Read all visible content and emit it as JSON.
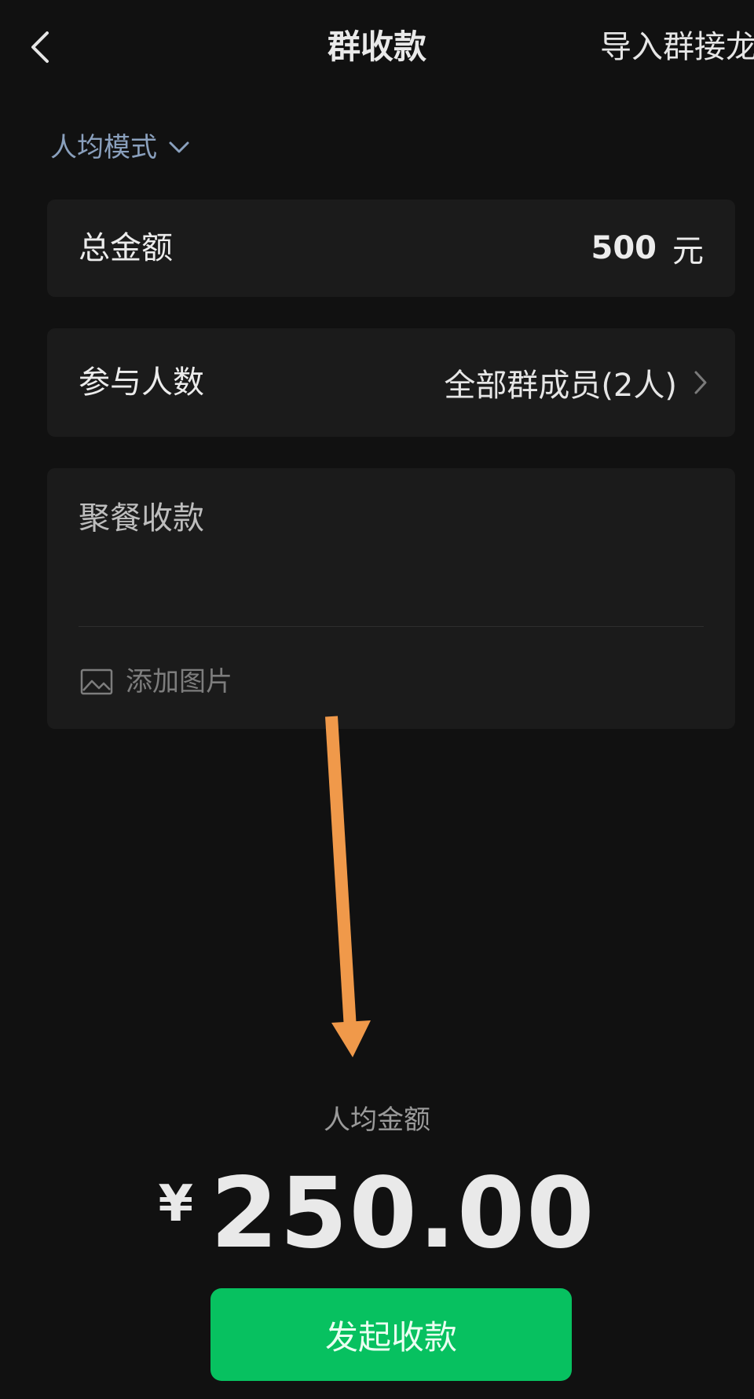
{
  "header": {
    "title": "群收款",
    "import_label": "导入群接龙"
  },
  "mode": {
    "label": "人均模式"
  },
  "total": {
    "label": "总金额",
    "value": "500",
    "unit": "元"
  },
  "participants": {
    "label": "参与人数",
    "value": "全部群成员(2人)"
  },
  "note": {
    "text": "聚餐收款",
    "add_image_label": "添加图片"
  },
  "per_person": {
    "label": "人均金额",
    "currency": "¥",
    "amount": "250.00"
  },
  "submit": {
    "label": "发起收款"
  },
  "colors": {
    "background": "#111111",
    "card": "#1b1b1b",
    "accent_green": "#07c160",
    "mode_blue": "#8aa0bd",
    "annotation_arrow": "#f0994a"
  },
  "icons": {
    "back": "chevron-left-icon",
    "mode_dropdown": "chevron-down-icon",
    "participants_more": "chevron-right-icon",
    "add_image": "image-icon"
  }
}
